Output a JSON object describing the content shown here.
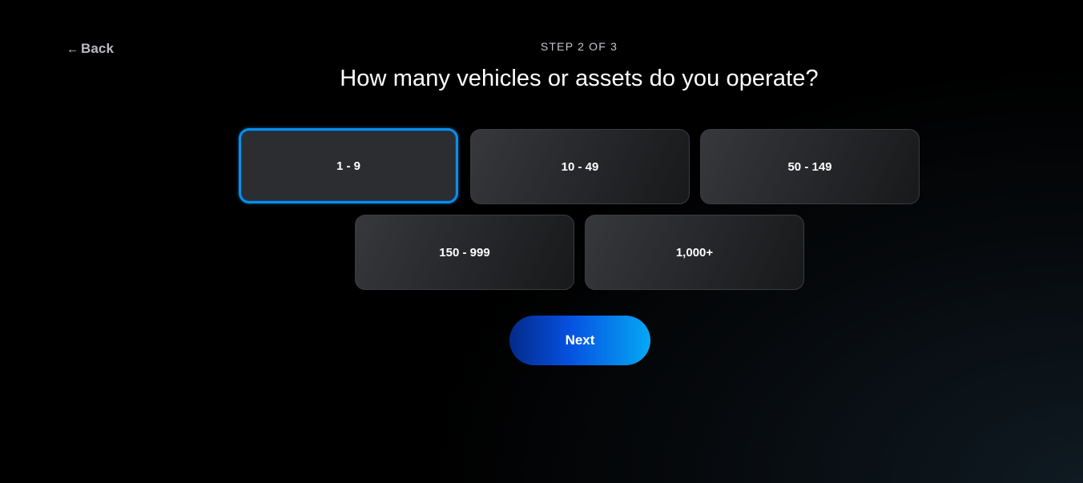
{
  "nav": {
    "back_label": "Back",
    "back_icon": "arrow-left-icon"
  },
  "header": {
    "step": "STEP 2 OF 3",
    "question": "How many vehicles or assets do you operate?"
  },
  "options": [
    {
      "label": "1 - 9",
      "selected": true
    },
    {
      "label": "10 - 49",
      "selected": false
    },
    {
      "label": "50 - 149",
      "selected": false
    },
    {
      "label": "150 - 999",
      "selected": false
    },
    {
      "label": "1,000+",
      "selected": false
    }
  ],
  "actions": {
    "next_label": "Next"
  },
  "colors": {
    "accent": "#0a8fe6",
    "button_gradient_start": "#032a8a",
    "button_gradient_end": "#05a8f5",
    "background": "#000000"
  }
}
